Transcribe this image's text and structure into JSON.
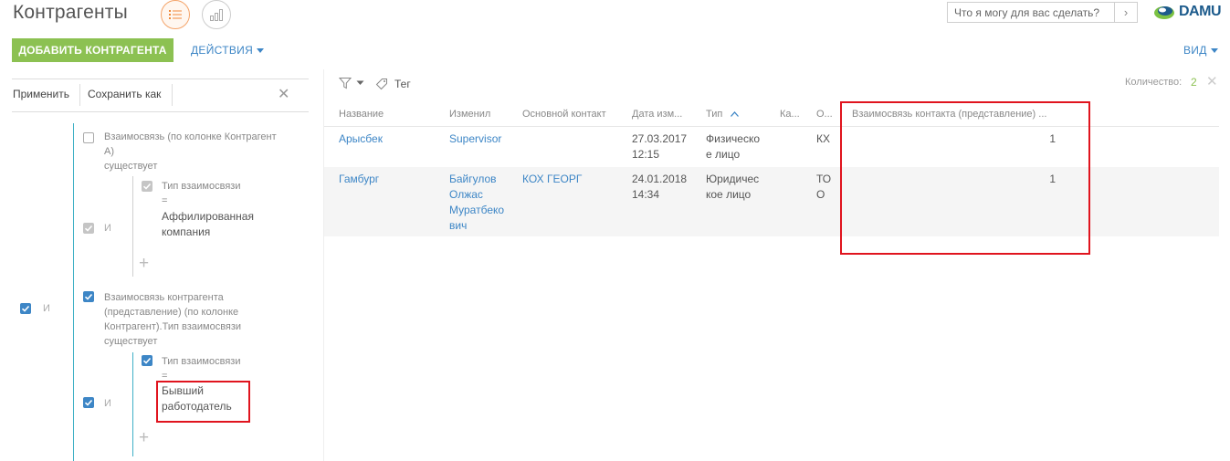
{
  "header": {
    "title": "Контрагенты",
    "search_placeholder": "Что я могу для вас сделать?",
    "logo_text": "DAMU",
    "add_button": "ДОБАВИТЬ КОНТРАГЕНТА",
    "actions": "ДЕЙСТВИЯ",
    "view": "ВИД"
  },
  "filter_panel": {
    "apply": "Применить",
    "save_as": "Сохранить как",
    "root_and": "И",
    "group1": {
      "text_line1": "Взаимосвязь (по колонке Контрагент",
      "text_line2": "А)",
      "text_line3": "существует",
      "and": "И",
      "cond_label": "Тип взаимосвязи",
      "cond_op": "=",
      "cond_value_line1": "Аффилированная",
      "cond_value_line2": "компания"
    },
    "group2": {
      "text_line1": "Взаимосвязь контрагента",
      "text_line2": "(представление) (по колонке",
      "text_line3": "Контрагент).Тип взаимосвязи",
      "text_line4": "существует",
      "and": "И",
      "cond_label": "Тип взаимосвязи",
      "cond_op": "=",
      "cond_value_line1": "Бывший",
      "cond_value_line2": "работодатель"
    }
  },
  "grid": {
    "tag_label": "Тег",
    "count_label": "Количество:",
    "count_value": "2",
    "columns": {
      "name": "Название",
      "modified_by": "Изменил",
      "contact": "Основной контакт",
      "date": "Дата изм...",
      "type": "Тип",
      "ka": "Ка...",
      "o": "О...",
      "relation": "Взаимосвязь контакта (представление) ..."
    },
    "rows": [
      {
        "name": "Арысбек",
        "modified_line1": "Supervisor",
        "modified_line2": "",
        "modified_line3": "",
        "modified_line4": "",
        "contact": "",
        "date_line1": "27.03.2017",
        "date_line2": "12:15",
        "type_line1": "Физическо",
        "type_line2": "е лицо",
        "o_line1": "КХ",
        "o_line2": "",
        "relation": "1"
      },
      {
        "name": "Гамбург",
        "modified_line1": "Байгулов",
        "modified_line2": "Олжас",
        "modified_line3": "Муратбеко",
        "modified_line4": "вич",
        "contact": "КОХ ГЕОРГ",
        "date_line1": "24.01.2018",
        "date_line2": "14:34",
        "type_line1": "Юридичес",
        "type_line2": "кое лицо",
        "o_line1": "ТО",
        "o_line2": "О",
        "relation": "1"
      }
    ]
  },
  "colors": {
    "accent_green": "#8cc152",
    "link_blue": "#3d86c6",
    "highlight_red": "#e0141e",
    "tree_line": "#3fb0c6"
  }
}
